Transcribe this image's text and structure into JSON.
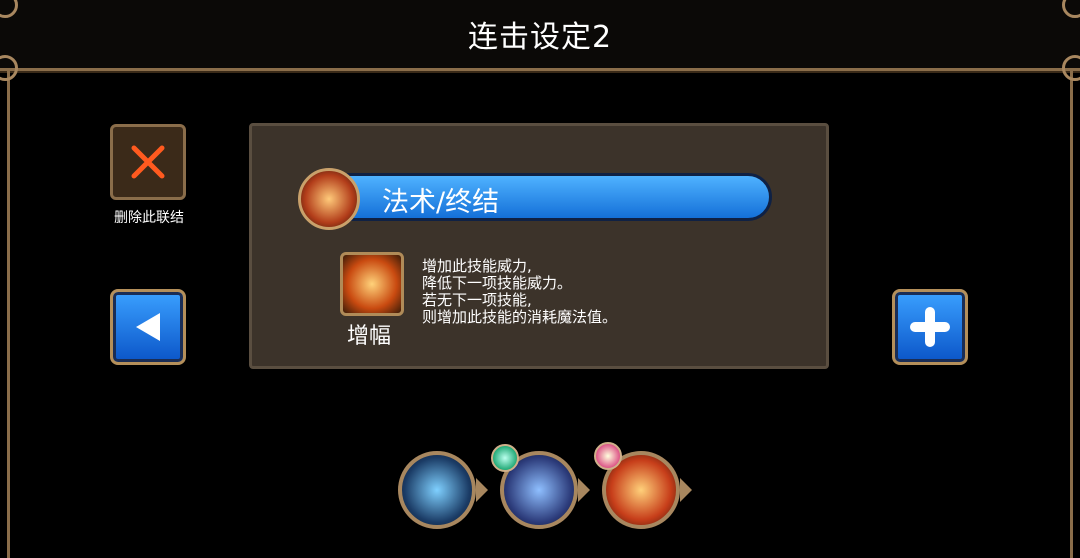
{
  "header": {
    "title": "连击设定2"
  },
  "left_controls": {
    "delete_label": "删除此联结"
  },
  "skill": {
    "name": "法术/终结"
  },
  "effect": {
    "name": "增幅",
    "description_lines": [
      "增加此技能威力,",
      "降低下一项技能威力。",
      "若无下一项技能,",
      "则增加此技能的消耗魔法值。"
    ]
  },
  "combo_chain": {
    "slots": [
      {
        "icon": "blue-slash-skill-icon"
      },
      {
        "icon": "cross-lightning-skill-icon",
        "badge": "green-badge-icon"
      },
      {
        "icon": "fire-dome-skill-icon",
        "badge": "fist-badge-icon"
      }
    ]
  },
  "colors": {
    "accent_blue": "#2f8df0",
    "panel": "#3c332a",
    "frame": "#8a6d4a"
  }
}
